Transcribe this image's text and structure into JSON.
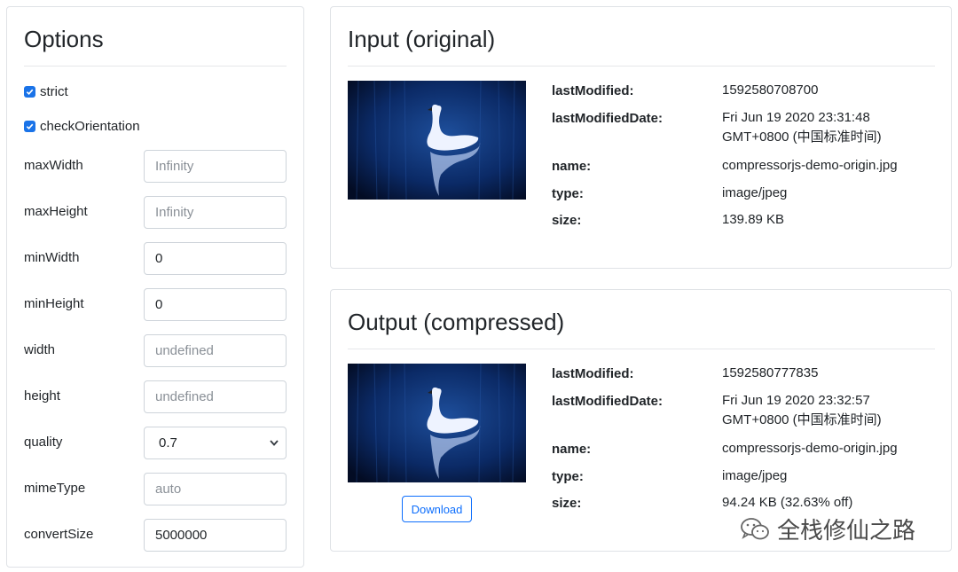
{
  "options": {
    "title": "Options",
    "checkboxes": [
      {
        "label": "strict",
        "checked": true
      },
      {
        "label": "checkOrientation",
        "checked": true
      }
    ],
    "fields": [
      {
        "label": "maxWidth",
        "value": "",
        "placeholder": "Infinity"
      },
      {
        "label": "maxHeight",
        "value": "",
        "placeholder": "Infinity"
      },
      {
        "label": "minWidth",
        "value": "0",
        "placeholder": ""
      },
      {
        "label": "minHeight",
        "value": "0",
        "placeholder": ""
      },
      {
        "label": "width",
        "value": "",
        "placeholder": "undefined"
      },
      {
        "label": "height",
        "value": "",
        "placeholder": "undefined"
      },
      {
        "label": "quality",
        "value": "0.7",
        "type": "select"
      },
      {
        "label": "mimeType",
        "value": "",
        "placeholder": "auto"
      },
      {
        "label": "convertSize",
        "value": "5000000",
        "placeholder": ""
      }
    ]
  },
  "input": {
    "title": "Input (original)",
    "keys": {
      "lastModified": "lastModified:",
      "lastModifiedDate": "lastModifiedDate:",
      "name": "name:",
      "type": "type:",
      "size": "size:"
    },
    "lastModified": "1592580708700",
    "lastModifiedDate_line1": "Fri Jun 19 2020 23:31:48",
    "lastModifiedDate_line2": "GMT+0800 (中国标准时间)",
    "name": "compressorjs-demo-origin.jpg",
    "type": "image/jpeg",
    "size": "139.89 KB"
  },
  "output": {
    "title": "Output (compressed)",
    "keys": {
      "lastModified": "lastModified:",
      "lastModifiedDate": "lastModifiedDate:",
      "name": "name:",
      "type": "type:",
      "size": "size:"
    },
    "lastModified": "1592580777835",
    "lastModifiedDate_line1": "Fri Jun 19 2020 23:32:57",
    "lastModifiedDate_line2": "GMT+0800 (中国标准时间)",
    "name": "compressorjs-demo-origin.jpg",
    "type": "image/jpeg",
    "size": "94.24 KB (32.63% off)",
    "download_label": "Download"
  },
  "watermark": {
    "text": "全栈修仙之路",
    "icon": "wechat-icon"
  },
  "colors": {
    "accent": "#1a73e8",
    "button": "#0d6efd"
  }
}
